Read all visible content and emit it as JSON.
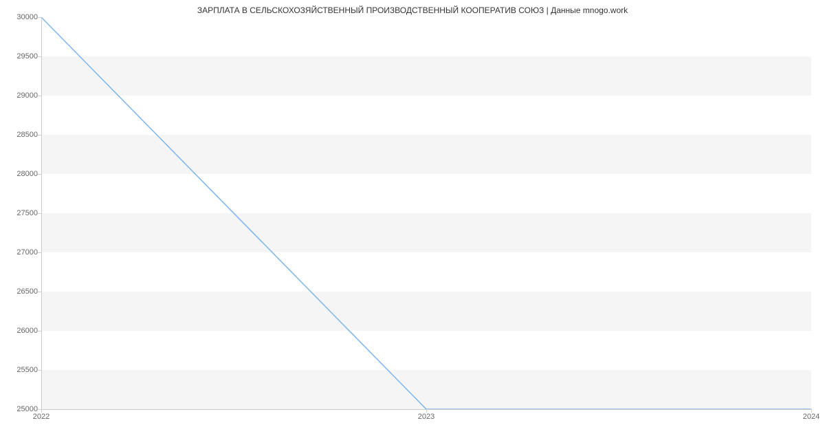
{
  "chart_data": {
    "type": "line",
    "title": "ЗАРПЛАТА В СЕЛЬСКОХОЗЯЙСТВЕННЫЙ ПРОИЗВОДСТВЕННЫЙ  КООПЕРАТИВ СОЮЗ | Данные mnogo.work",
    "x": [
      2022,
      2023,
      2024
    ],
    "values": [
      30000,
      25000,
      25000
    ],
    "xlabel": "",
    "ylabel": "",
    "xlim": [
      2022,
      2024
    ],
    "ylim": [
      25000,
      30000
    ],
    "x_ticks": [
      2022,
      2023,
      2024
    ],
    "y_ticks": [
      25000,
      25500,
      26000,
      26500,
      27000,
      27500,
      28000,
      28500,
      29000,
      29500,
      30000
    ],
    "line_color": "#7cb5ec",
    "grid_band_color": "#f5f5f5"
  }
}
